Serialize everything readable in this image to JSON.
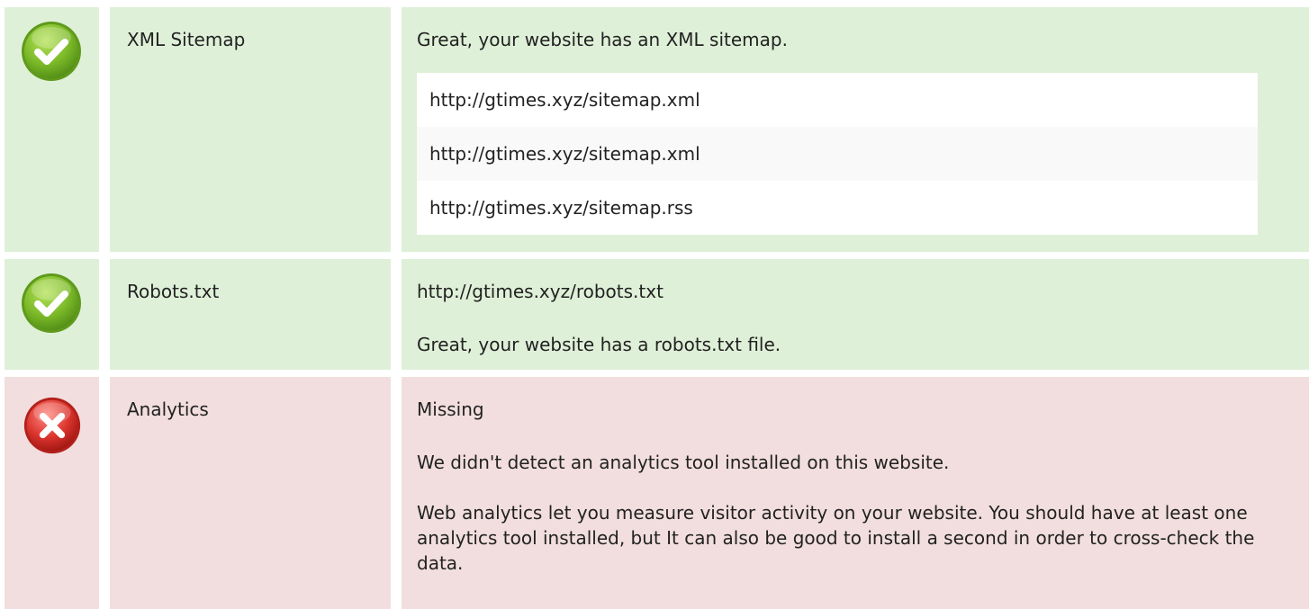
{
  "colors": {
    "pass_background": "#dff0d8",
    "fail_background": "#f2dede",
    "pass_icon": "#7ab828",
    "fail_icon": "#d9322c"
  },
  "checks": [
    {
      "status": "pass",
      "icon": "check-circle-icon",
      "label": "XML Sitemap",
      "message": "Great, your website has an XML sitemap.",
      "urls": [
        "http://gtimes.xyz/sitemap.xml",
        "http://gtimes.xyz/sitemap.xml",
        "http://gtimes.xyz/sitemap.rss"
      ]
    },
    {
      "status": "pass",
      "icon": "check-circle-icon",
      "label": "Robots.txt",
      "url": "http://gtimes.xyz/robots.txt",
      "message": "Great, your website has a robots.txt file."
    },
    {
      "status": "fail",
      "icon": "cross-circle-icon",
      "label": "Analytics",
      "value": "Missing",
      "message": "We didn't detect an analytics tool installed on this website.",
      "advice": "Web analytics let you measure visitor activity on your website. You should have at least one analytics tool installed, but It can also be good to install a second in order to cross-check the data."
    }
  ]
}
